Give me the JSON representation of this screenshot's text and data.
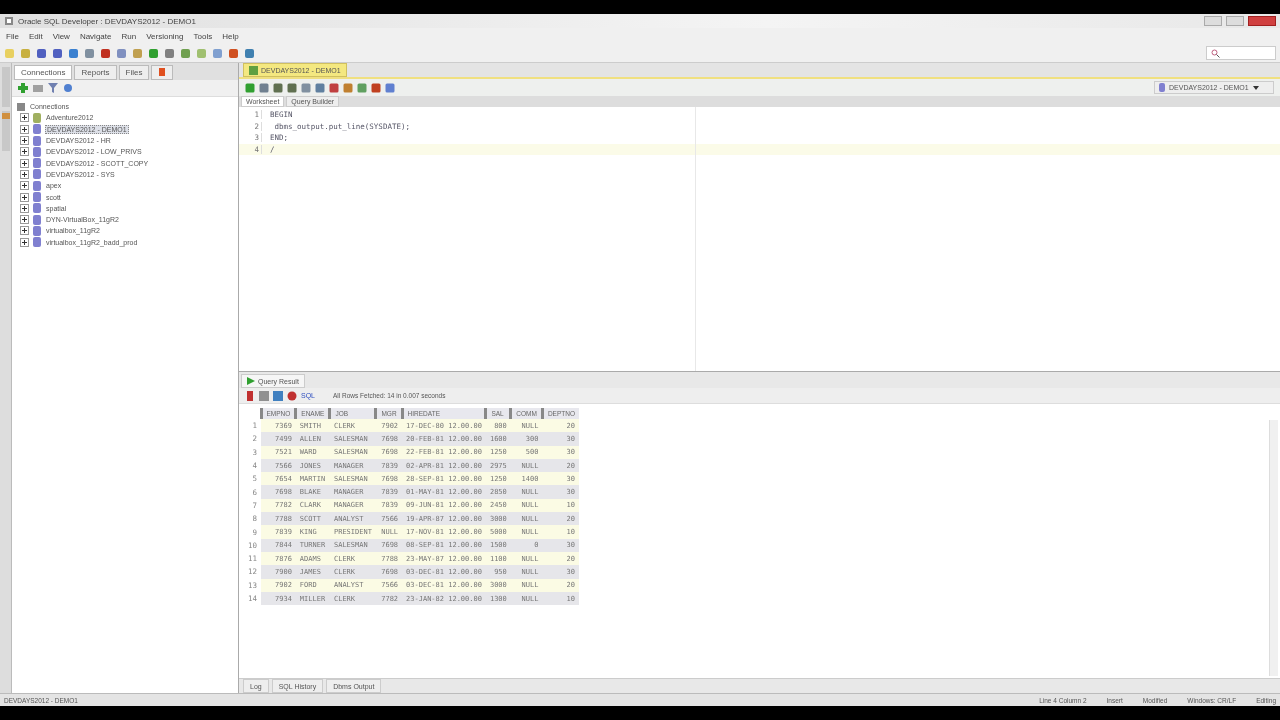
{
  "window": {
    "title": "Oracle SQL Developer : DEVDAYS2012 - DEMO1"
  },
  "menu": [
    "File",
    "Edit",
    "View",
    "Navigate",
    "Run",
    "Versioning",
    "Tools",
    "Help"
  ],
  "left_panel": {
    "tabs": [
      {
        "label": "Connections",
        "selected": true
      },
      {
        "label": "Reports",
        "selected": false
      },
      {
        "label": "Files",
        "selected": false
      }
    ],
    "tree": {
      "label": "Connections",
      "children": [
        {
          "label": "Adventure2012",
          "expanded": false,
          "selected": false
        },
        {
          "label": "DEVDAYS2012 - DEMO1",
          "expanded": false,
          "selected": true
        },
        {
          "label": "DEVDAYS2012 - HR",
          "expanded": false,
          "selected": false
        },
        {
          "label": "DEVDAYS2012 - LOW_PRIVS",
          "expanded": false,
          "selected": false
        },
        {
          "label": "DEVDAYS2012 - SCOTT_COPY",
          "expanded": false,
          "selected": false
        },
        {
          "label": "DEVDAYS2012 - SYS",
          "expanded": false,
          "selected": false
        },
        {
          "label": "apex",
          "expanded": false,
          "selected": false
        },
        {
          "label": "scott",
          "expanded": false,
          "selected": false
        },
        {
          "label": "spatial",
          "expanded": false,
          "selected": false
        },
        {
          "label": "DYN-VirtualBox_11gR2",
          "expanded": false,
          "selected": false
        },
        {
          "label": "virtualbox_11gR2",
          "expanded": false,
          "selected": false
        },
        {
          "label": "virtualbox_11gR2_badd_prod",
          "expanded": false,
          "selected": false
        }
      ]
    }
  },
  "editor": {
    "tab": "DEVDAYS2012 - DEMO1",
    "connection": "DEVDAYS2012 - DEMO1",
    "subtabs": [
      {
        "label": "Worksheet",
        "selected": true
      },
      {
        "label": "Query Builder",
        "selected": false
      }
    ],
    "lines": [
      {
        "number": "1",
        "text": "BEGIN"
      },
      {
        "number": "2",
        "text": " dbms_output.put_line(SYSDATE);"
      },
      {
        "number": "3",
        "text": "END;"
      },
      {
        "number": "4",
        "text": "/"
      }
    ]
  },
  "results": {
    "tab": "Query Result",
    "sql_label": "SQL",
    "status": "All Rows Fetched: 14 in 0.007 seconds",
    "columns": [
      "EMPNO",
      "ENAME",
      "JOB",
      "MGR",
      "HIREDATE",
      "SAL",
      "COMM",
      "DEPTNO"
    ],
    "rows": [
      {
        "number": "1",
        "cells": [
          "7369",
          "SMITH",
          "CLERK",
          "7902",
          "17-DEC-80 12.00.00",
          "800",
          "NULL",
          "20"
        ]
      },
      {
        "number": "2",
        "cells": [
          "7499",
          "ALLEN",
          "SALESMAN",
          "7698",
          "20-FEB-81 12.00.00",
          "1600",
          "300",
          "30"
        ]
      },
      {
        "number": "3",
        "cells": [
          "7521",
          "WARD",
          "SALESMAN",
          "7698",
          "22-FEB-81 12.00.00",
          "1250",
          "500",
          "30"
        ]
      },
      {
        "number": "4",
        "cells": [
          "7566",
          "JONES",
          "MANAGER",
          "7839",
          "02-APR-81 12.00.00",
          "2975",
          "NULL",
          "20"
        ]
      },
      {
        "number": "5",
        "cells": [
          "7654",
          "MARTIN",
          "SALESMAN",
          "7698",
          "28-SEP-81 12.00.00",
          "1250",
          "1400",
          "30"
        ]
      },
      {
        "number": "6",
        "cells": [
          "7698",
          "BLAKE",
          "MANAGER",
          "7839",
          "01-MAY-81 12.00.00",
          "2850",
          "NULL",
          "30"
        ]
      },
      {
        "number": "7",
        "cells": [
          "7782",
          "CLARK",
          "MANAGER",
          "7839",
          "09-JUN-81 12.00.00",
          "2450",
          "NULL",
          "10"
        ]
      },
      {
        "number": "8",
        "cells": [
          "7788",
          "SCOTT",
          "ANALYST",
          "7566",
          "19-APR-87 12.00.00",
          "3000",
          "NULL",
          "20"
        ]
      },
      {
        "number": "9",
        "cells": [
          "7839",
          "KING",
          "PRESIDENT",
          "NULL",
          "17-NOV-81 12.00.00",
          "5000",
          "NULL",
          "10"
        ]
      },
      {
        "number": "10",
        "cells": [
          "7844",
          "TURNER",
          "SALESMAN",
          "7698",
          "08-SEP-81 12.00.00",
          "1500",
          "0",
          "30"
        ]
      },
      {
        "number": "11",
        "cells": [
          "7876",
          "ADAMS",
          "CLERK",
          "7788",
          "23-MAY-87 12.00.00",
          "1100",
          "NULL",
          "20"
        ]
      },
      {
        "number": "12",
        "cells": [
          "7900",
          "JAMES",
          "CLERK",
          "7698",
          "03-DEC-81 12.00.00",
          "950",
          "NULL",
          "30"
        ]
      },
      {
        "number": "13",
        "cells": [
          "7902",
          "FORD",
          "ANALYST",
          "7566",
          "03-DEC-81 12.00.00",
          "3000",
          "NULL",
          "20"
        ]
      },
      {
        "number": "14",
        "cells": [
          "7934",
          "MILLER",
          "CLERK",
          "7782",
          "23-JAN-82 12.00.00",
          "1300",
          "NULL",
          "10"
        ]
      }
    ]
  },
  "bottom_tabs": [
    {
      "label": "Log",
      "selected": false
    },
    {
      "label": "SQL History",
      "selected": false
    },
    {
      "label": "Dbms Output",
      "selected": false
    }
  ],
  "status_bar": {
    "connection": "DEVDAYS2012 - DEMO1",
    "position": "Line 4 Column 2",
    "mode": "Insert",
    "modified": "Modified",
    "line_endings": "Windows: CR/LF",
    "state": "Editing"
  }
}
